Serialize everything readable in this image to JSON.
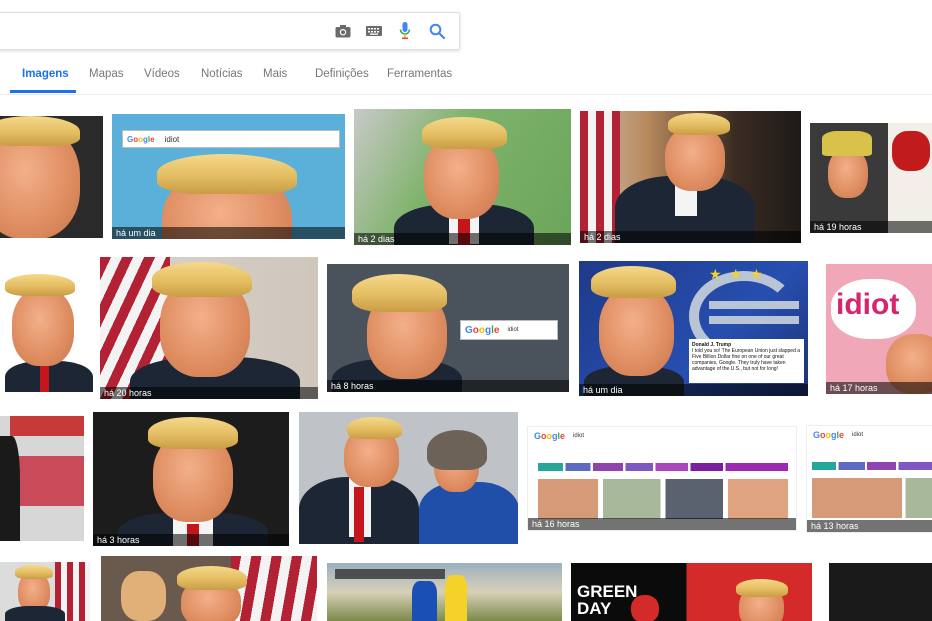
{
  "search": {
    "value": "",
    "camera_icon": "camera-icon",
    "keyboard_icon": "keyboard-icon",
    "mic_icon": "microphone-icon",
    "search_icon": "search-icon"
  },
  "tabs": [
    {
      "label": "Imagens",
      "active": true
    },
    {
      "label": "Mapas",
      "active": false
    },
    {
      "label": "Vídeos",
      "active": false
    },
    {
      "label": "Notícias",
      "active": false
    },
    {
      "label": "Mais",
      "active": false
    },
    {
      "label": "Definições",
      "active": false
    },
    {
      "label": "Ferramentas",
      "active": false
    }
  ],
  "results": [
    {
      "caption": ""
    },
    {
      "caption": "há um dia",
      "search_text": "idiot"
    },
    {
      "caption": "há 2 dias"
    },
    {
      "caption": "há 2 dias"
    },
    {
      "caption": "há 19 horas"
    },
    {
      "caption": ""
    },
    {
      "caption": "há 20 horas"
    },
    {
      "caption": "há 8 horas",
      "search_text": "idiot"
    },
    {
      "caption": "há um dia",
      "tweet_author": "Donald J. Trump",
      "tweet_text": "I told you so! The European Union just slapped a Five Billion Dollar fine on one of our great companies, Google. They truly have taken advantage of the U.S., but not for long!"
    },
    {
      "caption": "há 17 horas",
      "sign_text": "idiot"
    },
    {
      "caption": ""
    },
    {
      "caption": "há 3 horas"
    },
    {
      "caption": ""
    },
    {
      "caption": "há 16 horas",
      "search_text": "idiot"
    },
    {
      "caption": "há 13 horas",
      "search_text": "idiot"
    },
    {
      "caption": ""
    },
    {
      "caption": ""
    },
    {
      "caption": ""
    },
    {
      "caption": "",
      "album_text": "GREEN DAY"
    },
    {
      "caption": ""
    }
  ],
  "brand": {
    "google_letters": [
      "G",
      "o",
      "o",
      "g",
      "l",
      "e"
    ]
  },
  "colors": {
    "accent": "#1a73e8",
    "tab_text": "#777777"
  }
}
